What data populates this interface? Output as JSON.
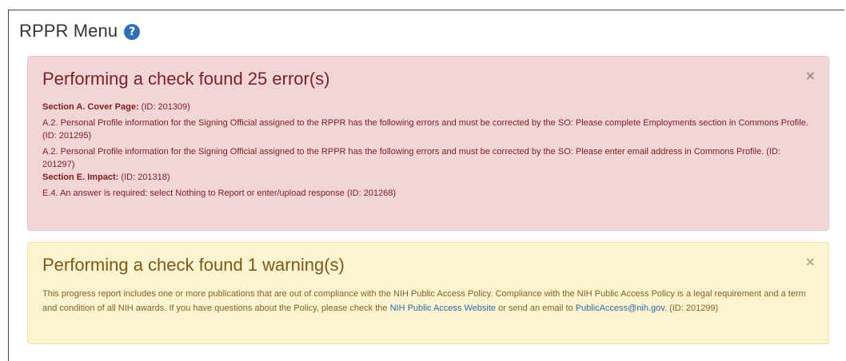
{
  "page": {
    "title": "RPPR Menu",
    "help_icon": "question-circle"
  },
  "errors": {
    "heading": "Performing a check found 25 error(s)",
    "close": "×",
    "section_a": {
      "label": "Section A. Cover Page:",
      "id": " (ID: 201309)"
    },
    "item_1": "A.2. Personal Profile information for the Signing Official assigned to the RPPR has the following errors and must be corrected by the SO: Please complete Employments section in Commons Profile. (ID: 201295)",
    "item_2": "A.2. Personal Profile information for the Signing Official assigned to the RPPR has the following errors and must be corrected by the SO: Please enter email address in Commons Profile. (ID: 201297)",
    "section_e": {
      "label": "Section E. Impact:",
      "id": " (ID: 201318)"
    },
    "item_3": "E.4. An answer is required: select Nothing to Report or enter/upload response (ID: 201268)"
  },
  "warnings": {
    "heading": "Performing a check found 1 warning(s)",
    "close": "×",
    "text_1": "This progress report includes one or more publications that are out of compliance with the NIH Public Access Policy. Compliance with the NIH Public Access Policy is a legal requirement and a term and condition of all NIH awards. If you have questions about the Policy, please check the ",
    "link_website": "NIH Public Access Website",
    "text_2": " or send an email to ",
    "link_email": "PublicAccess@nih.gov",
    "text_3": ". (ID: 201299)"
  },
  "colors": {
    "error_bg": "#f2d5d7",
    "warning_bg": "#fcf3d0",
    "link": "#2d6aa8",
    "help_icon": "#2f6fb5"
  }
}
